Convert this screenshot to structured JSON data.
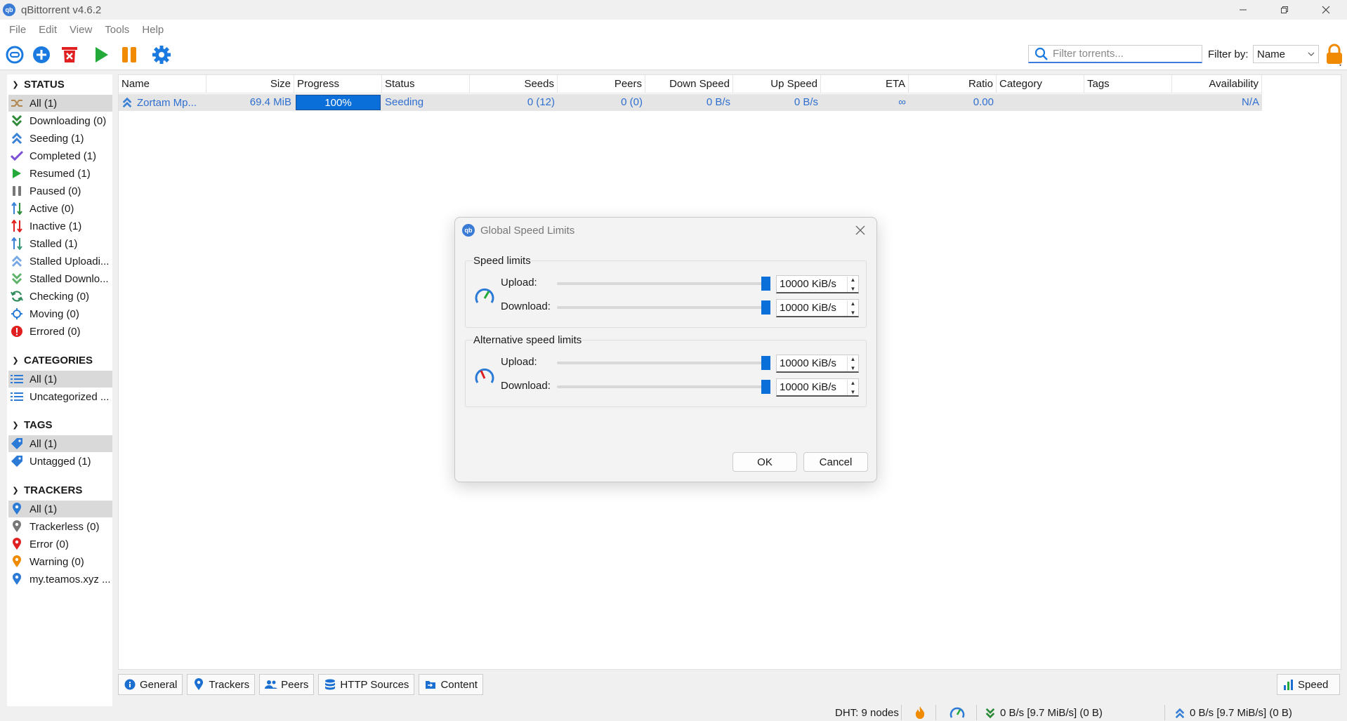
{
  "window": {
    "title": "qBittorrent v4.6.2",
    "app_icon_text": "qb"
  },
  "menu": [
    "File",
    "Edit",
    "View",
    "Tools",
    "Help"
  ],
  "toolbar": {
    "search_placeholder": "Filter torrents...",
    "filter_label": "Filter by:",
    "filter_value": "Name"
  },
  "sidebar": {
    "status_header": "STATUS",
    "status_items": [
      {
        "label": "All (1)",
        "icon": "shuffle-icon",
        "color": "#b08850"
      },
      {
        "label": "Downloading (0)",
        "icon": "downloading-icon",
        "color": "#2e8b3a"
      },
      {
        "label": "Seeding (1)",
        "icon": "seeding-icon",
        "color": "#3b82d6"
      },
      {
        "label": "Completed (1)",
        "icon": "checkmark-icon",
        "color": "#7b4fd6"
      },
      {
        "label": "Resumed (1)",
        "icon": "play-icon",
        "color": "#22a93a"
      },
      {
        "label": "Paused (0)",
        "icon": "pause-icon",
        "color": "#777777"
      },
      {
        "label": "Active (0)",
        "icon": "active-arrows-icon",
        "color": "#2e8b3a"
      },
      {
        "label": "Inactive (1)",
        "icon": "inactive-arrows-icon",
        "color": "#e02020"
      },
      {
        "label": "Stalled (1)",
        "icon": "stalled-arrows-icon",
        "color": "#3b9a7a"
      },
      {
        "label": "Stalled Uploadi...",
        "icon": "stalled-upload-icon",
        "color": "#3b82d6"
      },
      {
        "label": "Stalled Downlo...",
        "icon": "stalled-download-icon",
        "color": "#2e8b3a"
      },
      {
        "label": "Checking (0)",
        "icon": "checking-refresh-icon",
        "color": "#2e8b5a"
      },
      {
        "label": "Moving (0)",
        "icon": "moving-icon",
        "color": "#2a7ad6"
      },
      {
        "label": "Errored (0)",
        "icon": "error-icon",
        "color": "#e02020"
      }
    ],
    "categories_header": "CATEGORIES",
    "category_items": [
      "All (1)",
      "Uncategorized ..."
    ],
    "tags_header": "TAGS",
    "tag_items": [
      "All (1)",
      "Untagged (1)"
    ],
    "trackers_header": "TRACKERS",
    "tracker_items": [
      {
        "label": "All (1)",
        "color": "#2a7ad6"
      },
      {
        "label": "Trackerless (0)",
        "color": "#777777"
      },
      {
        "label": "Error (0)",
        "color": "#e02020"
      },
      {
        "label": "Warning (0)",
        "color": "#f08a00"
      },
      {
        "label": "my.teamos.xyz ...",
        "color": "#2a7ad6"
      }
    ]
  },
  "torrent_list": {
    "columns": [
      "Name",
      "Size",
      "Progress",
      "Status",
      "Seeds",
      "Peers",
      "Down Speed",
      "Up Speed",
      "ETA",
      "Ratio",
      "Category",
      "Tags",
      "Availability"
    ],
    "rows": [
      {
        "name": "Zortam Mp...",
        "size": "69.4 MiB",
        "progress": "100%",
        "progress_fraction": 1.0,
        "status": "Seeding",
        "seeds": "0 (12)",
        "peers": "0 (0)",
        "down_speed": "0 B/s",
        "up_speed": "0 B/s",
        "eta": "∞",
        "ratio": "0.00",
        "category": "",
        "tags": "",
        "availability": "N/A"
      }
    ]
  },
  "bottom_tabs": [
    "General",
    "Trackers",
    "Peers",
    "HTTP Sources",
    "Content"
  ],
  "speed_tab": "Speed",
  "statusbar": {
    "dht": "DHT: 9 nodes",
    "download": "0 B/s [9.7 MiB/s] (0 B)",
    "upload": "0 B/s [9.7 MiB/s] (0 B)"
  },
  "dialog": {
    "title": "Global Speed Limits",
    "speed_limits": {
      "title": "Speed limits",
      "upload_label": "Upload:",
      "upload_value": "10000 KiB/s",
      "download_label": "Download:",
      "download_value": "10000 KiB/s"
    },
    "alt_speed_limits": {
      "title": "Alternative speed limits",
      "upload_label": "Upload:",
      "upload_value": "10000 KiB/s",
      "download_label": "Download:",
      "download_value": "10000 KiB/s"
    },
    "ok_label": "OK",
    "cancel_label": "Cancel"
  },
  "colors": {
    "accent": "#0a6fd8",
    "link": "#2f6fd0",
    "selection": "#d9d9d9"
  }
}
